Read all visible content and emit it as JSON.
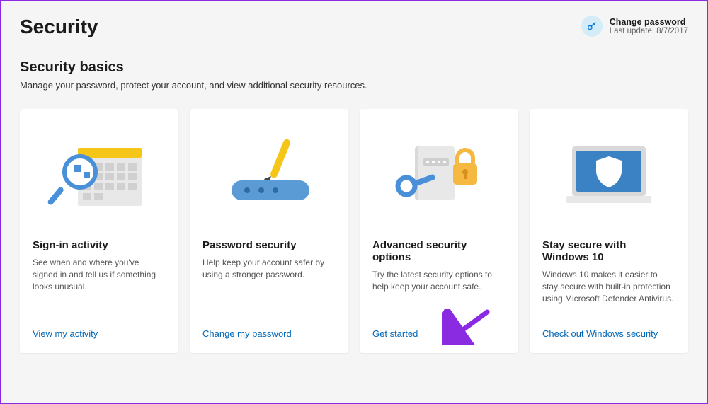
{
  "header": {
    "title": "Security",
    "change_password": {
      "title": "Change password",
      "subtitle": "Last update: 8/7/2017"
    }
  },
  "section": {
    "title": "Security basics",
    "description": "Manage your password, protect your account, and view additional security resources."
  },
  "cards": [
    {
      "title": "Sign-in activity",
      "description": "See when and where you've signed in and tell us if something looks unusual.",
      "link": "View my activity"
    },
    {
      "title": "Password security",
      "description": "Help keep your account safer by using a stronger password.",
      "link": "Change my password"
    },
    {
      "title": "Advanced security options",
      "description": "Try the latest security options to help keep your account safe.",
      "link": "Get started"
    },
    {
      "title": "Stay secure with Windows 10",
      "description": "Windows 10 makes it easier to stay secure with built-in protection using Microsoft Defender Antivirus.",
      "link": "Check out Windows security"
    }
  ]
}
